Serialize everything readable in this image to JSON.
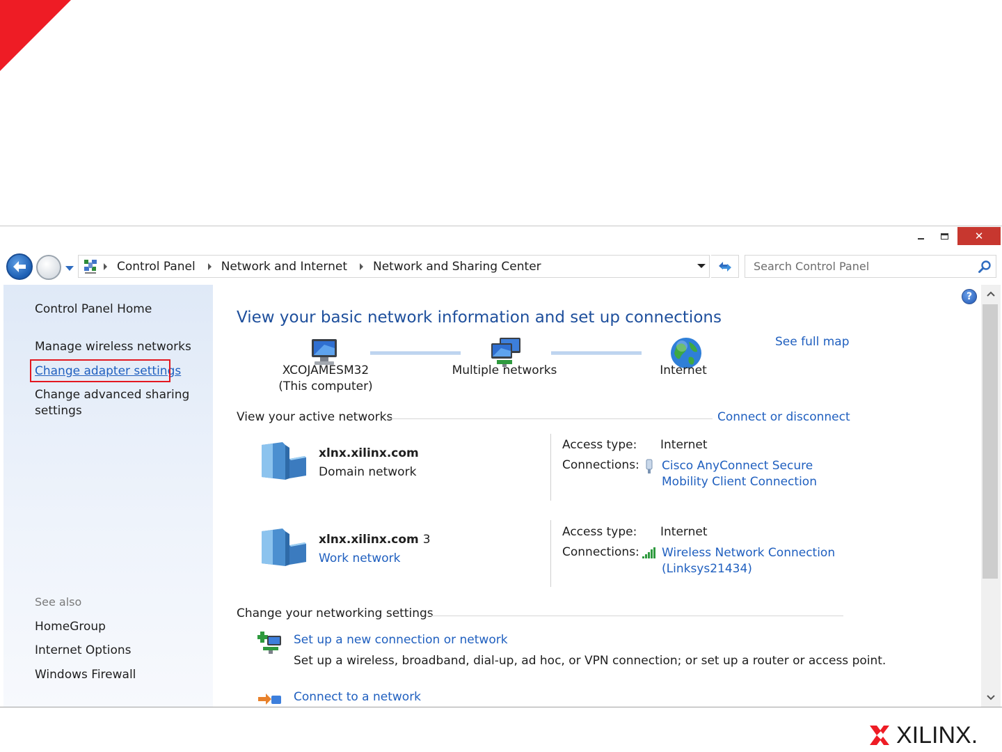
{
  "window": {
    "close_glyph": "✕"
  },
  "address_bar": {
    "crumbs": [
      "Control Panel",
      "Network and Internet",
      "Network and Sharing Center"
    ]
  },
  "search": {
    "placeholder": "Search Control Panel"
  },
  "sidebar": {
    "home": "Control Panel Home",
    "items": [
      "Manage wireless networks",
      "Change adapter settings",
      "Change advanced sharing settings"
    ],
    "see_also_header": "See also",
    "see_also": [
      "HomeGroup",
      "Internet Options",
      "Windows Firewall"
    ]
  },
  "main": {
    "title": "View your basic network information and set up connections",
    "see_full_map": "See full map",
    "map": {
      "computer_name": "XCOJAMESM32",
      "computer_sub": "(This computer)",
      "middle": "Multiple networks",
      "internet": "Internet"
    },
    "active_header": "View your active networks",
    "connect_link": "Connect or disconnect",
    "networks": [
      {
        "name": "xlnx.xilinx.com",
        "number": "",
        "type": "Domain network",
        "access_label": "Access type:",
        "access_value": "Internet",
        "conn_label": "Connections:",
        "connection": "Cisco AnyConnect Secure Mobility Client Connection"
      },
      {
        "name": "xlnx.xilinx.com",
        "number": "3",
        "type": "Work network",
        "access_label": "Access type:",
        "access_value": "Internet",
        "conn_label": "Connections:",
        "connection": "Wireless Network Connection (Linksys21434)"
      }
    ],
    "settings_header": "Change your networking settings",
    "tasks": [
      {
        "link": "Set up a new connection or network",
        "desc": "Set up a wireless, broadband, dial-up, ad hoc, or VPN connection; or set up a router or access point."
      },
      {
        "link": "Connect to a network",
        "desc": ""
      }
    ]
  },
  "help_glyph": "?",
  "brand": {
    "logo_text": "XILINX.",
    "accent": "#ee1c25",
    "link_color": "#1f5fbf",
    "title_color": "#1e4f9c"
  }
}
